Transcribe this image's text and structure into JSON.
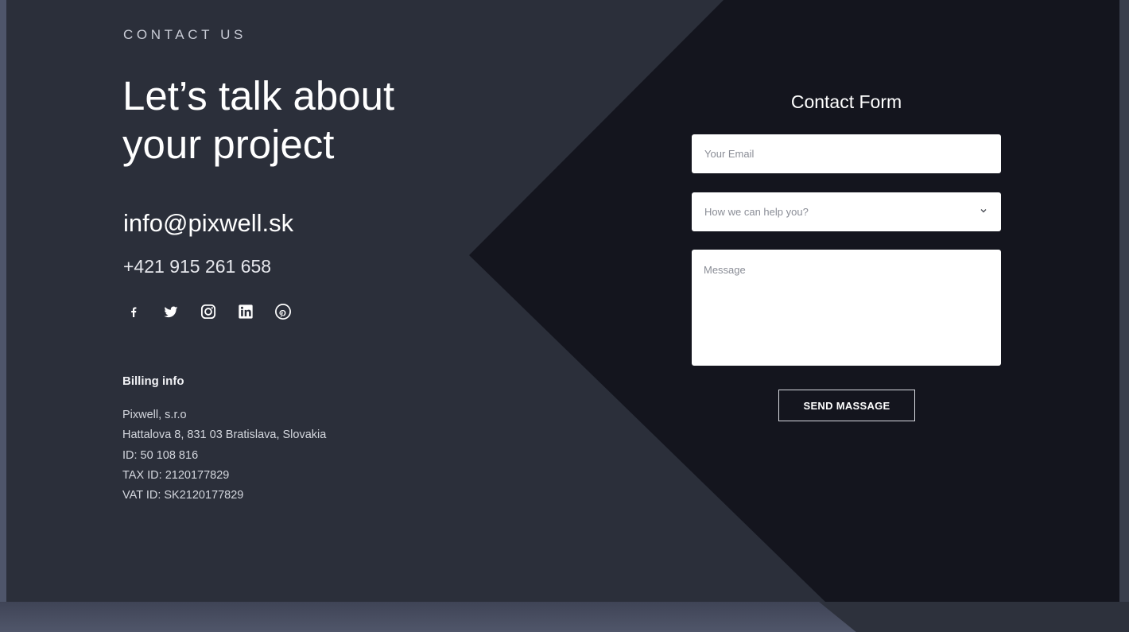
{
  "section": {
    "eyebrow": "CONTACT US",
    "headline": "Let’s talk about your project"
  },
  "contact": {
    "email": "info@pixwell.sk",
    "phone": "+421 915 261 658"
  },
  "social": [
    {
      "icon": "facebook-icon"
    },
    {
      "icon": "twitter-icon"
    },
    {
      "icon": "instagram-icon"
    },
    {
      "icon": "linkedin-icon"
    },
    {
      "icon": "pinterest-icon"
    }
  ],
  "billing": {
    "title": "Billing info",
    "lines": [
      "Pixwell, s.r.o",
      "Hattalova 8, 831 03 Bratislava, Slovakia",
      "ID: 50 108 816",
      "TAX ID: 2120177829",
      "VAT ID: SK2120177829"
    ]
  },
  "form": {
    "title": "Contact Form",
    "email_placeholder": "Your Email",
    "help_placeholder": "How we can help you?",
    "message_placeholder": "Message",
    "submit_label": "SEND MASSAGE"
  },
  "colors": {
    "panel": "#2b2f3a",
    "dark_panel": "#14151e",
    "text_primary": "#ffffff"
  }
}
